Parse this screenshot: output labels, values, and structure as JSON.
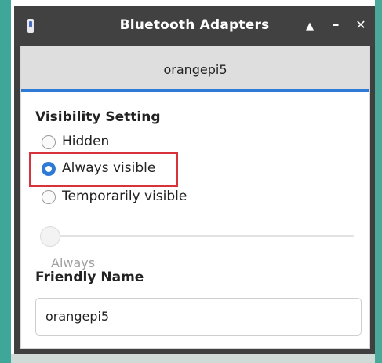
{
  "window": {
    "title": "Bluetooth Adapters",
    "controls": {
      "maximize": "▲",
      "minimize": "–",
      "close": "✕"
    }
  },
  "tabs": [
    {
      "label": "orangepi5",
      "selected": true
    }
  ],
  "visibility": {
    "heading": "Visibility Setting",
    "options": [
      {
        "label": "Hidden",
        "selected": false
      },
      {
        "label": "Always visible",
        "selected": true
      },
      {
        "label": "Temporarily visible",
        "selected": false
      }
    ],
    "timeout_caption": "Always",
    "timeout_level": 0
  },
  "friendly_name": {
    "heading": "Friendly Name",
    "value": "orangepi5"
  },
  "colors": {
    "accent": "#2f7ad5",
    "titlebar": "#414141",
    "annotation": "#d8323a",
    "desktop": "#3fa79a"
  },
  "icons": {
    "app": "bluetooth-adapter-icon"
  }
}
